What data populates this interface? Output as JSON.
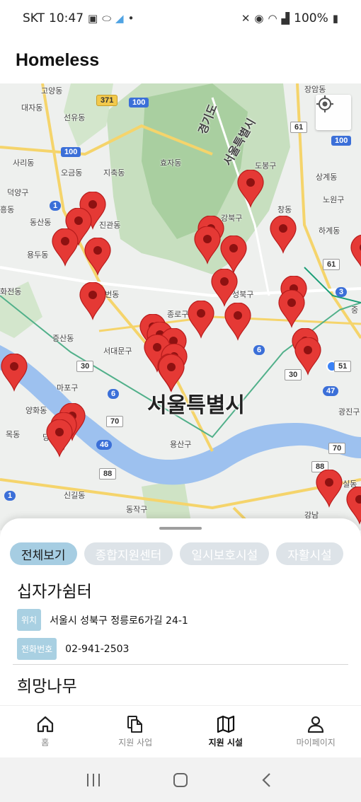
{
  "status_bar": {
    "carrier": "SKT",
    "time": "10:47",
    "battery": "100%"
  },
  "app": {
    "title": "Homeless"
  },
  "map": {
    "city_label": "서울특별시",
    "labels": [
      "고양동",
      "대자동",
      "선유동",
      "효자동",
      "경기도",
      "서울특별시",
      "도봉구",
      "장암동",
      "상계동",
      "노원구",
      "하계동",
      "창동",
      "강북구",
      "오금동",
      "지축동",
      "사리동",
      "덕양구",
      "흥동",
      "동산동",
      "용두동",
      "진관동",
      "화전동",
      "녹번동",
      "종로구",
      "성북구",
      "증산동",
      "서대문구",
      "마포구",
      "양화동",
      "목동",
      "당산",
      "신길동",
      "동작구",
      "용산구",
      "광진구",
      "잠실동",
      "강남",
      "중"
    ],
    "route_badges": [
      "371",
      "100",
      "100",
      "100",
      "61",
      "61",
      "1",
      "3",
      "6",
      "6",
      "30",
      "30",
      "51",
      "47",
      "70",
      "70",
      "46",
      "88",
      "88",
      "1"
    ]
  },
  "sheet": {
    "filters": [
      "전체보기",
      "종합지원센터",
      "일시보호시설",
      "자활시설"
    ],
    "active_filter": "전체보기",
    "facilities": [
      {
        "name": "십자가쉼터",
        "location_label": "위치",
        "location": "서울시 성북구 정릉로6가길 24-1",
        "phone_label": "전화번호",
        "phone": "02-941-2503"
      },
      {
        "name": "희망나무"
      }
    ]
  },
  "bottom_nav": {
    "items": [
      {
        "label": "홈",
        "icon": "home-icon"
      },
      {
        "label": "지원 사업",
        "icon": "documents-icon"
      },
      {
        "label": "지원 시설",
        "icon": "map-icon"
      },
      {
        "label": "마이페이지",
        "icon": "person-icon"
      }
    ],
    "active": "지원 시설"
  },
  "colors": {
    "pin": "#e53935",
    "chip_active": "#a6cde2",
    "chip_inactive": "#dde3e8",
    "tag": "#a9d0e2"
  }
}
